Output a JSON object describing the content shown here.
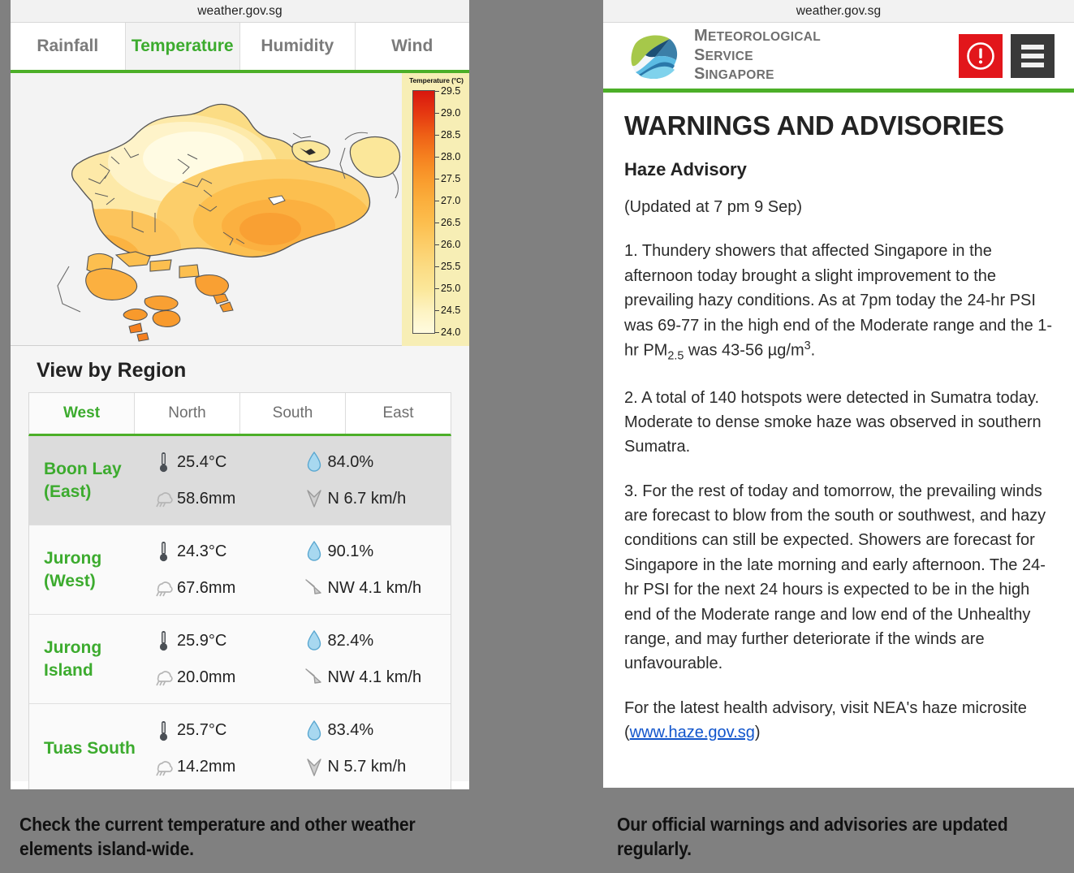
{
  "colors": {
    "accent_green": "#4caf28",
    "alert_red": "#e2161b",
    "menu_dark": "#3a3a3a",
    "link_blue": "#1155cc",
    "page_background": "#808080"
  },
  "left_screen": {
    "url": "weather.gov.sg",
    "tabs": [
      {
        "label": "Rainfall",
        "active": false
      },
      {
        "label": "Temperature",
        "active": true
      },
      {
        "label": "Humidity",
        "active": false
      },
      {
        "label": "Wind",
        "active": false
      }
    ],
    "map": {
      "legend_title": "Temperature (°C)",
      "legend_ticks": [
        "29.5",
        "29.0",
        "28.5",
        "28.0",
        "27.5",
        "27.0",
        "26.5",
        "26.0",
        "25.5",
        "25.0",
        "24.5",
        "24.0"
      ]
    },
    "region_section": {
      "title": "View by Region",
      "region_tabs": [
        {
          "label": "West",
          "active": true
        },
        {
          "label": "North",
          "active": false
        },
        {
          "label": "South",
          "active": false
        },
        {
          "label": "East",
          "active": false
        }
      ],
      "rows": [
        {
          "name": "Boon Lay (East)",
          "name_line1": "Boon Lay",
          "name_line2": "(East)",
          "temperature": "25.4°C",
          "rainfall": "58.6mm",
          "humidity": "84.0%",
          "wind": "N 6.7 km/h",
          "wind_icon": "wind-arrow-n"
        },
        {
          "name": "Jurong (West)",
          "name_line1": "Jurong",
          "name_line2": "(West)",
          "temperature": "24.3°C",
          "rainfall": "67.6mm",
          "humidity": "90.1%",
          "wind": "NW 4.1 km/h",
          "wind_icon": "wind-arrow-nw"
        },
        {
          "name": "Jurong Island",
          "name_line1": "Jurong",
          "name_line2": "Island",
          "temperature": "25.9°C",
          "rainfall": "20.0mm",
          "humidity": "82.4%",
          "wind": "NW 4.1 km/h",
          "wind_icon": "wind-arrow-nw"
        },
        {
          "name": "Tuas South",
          "name_line1": "Tuas South",
          "name_line2": "",
          "temperature": "25.7°C",
          "rainfall": "14.2mm",
          "humidity": "83.4%",
          "wind": "N 5.7 km/h",
          "wind_icon": "wind-arrow-n"
        }
      ]
    },
    "caption": "Check the current temperature and other weather elements island-wide."
  },
  "right_screen": {
    "url": "weather.gov.sg",
    "logo": {
      "line1": "Meteorological",
      "line2": "Service",
      "line3": "Singapore"
    },
    "header_buttons": {
      "alert": "alert-icon",
      "menu": "hamburger-menu-icon"
    },
    "heading": "WARNINGS AND ADVISORIES",
    "subheading": "Haze Advisory",
    "updated": "(Updated at 7 pm 9 Sep)",
    "paragraph1_a": "1. Thundery showers that affected Singapore in the afternoon today brought a slight improvement to the prevailing hazy conditions. As at 7pm today the 24-hr PSI was 69-77 in the high end of the Moderate range and the 1-hr PM",
    "paragraph1_sub": "2.5",
    "paragraph1_b": " was 43-56 µg/m",
    "paragraph1_sup": "3",
    "paragraph1_c": ".",
    "paragraph2": "2. A total of 140 hotspots were detected in Sumatra today. Moderate to dense smoke haze was observed in southern Sumatra.",
    "paragraph3": "3. For the rest of today and tomorrow, the prevailing winds are forecast to blow from the south or southwest, and hazy conditions can still be expected. Showers are forecast for Singapore in the late morning and early afternoon. The 24-hr PSI for the next 24 hours is expected to be in the high end of the Moderate range and low end of the Unhealthy range, and may further deteriorate if the winds are unfavourable.",
    "paragraph4_a": "For the latest health advisory, visit NEA's haze microsite (",
    "paragraph4_link": "www.haze.gov.sg",
    "paragraph4_b": ")",
    "caption": "Our official warnings and advisories are updated regularly."
  },
  "chart_data": {
    "type": "heatmap",
    "title": "Temperature (°C)",
    "description": "Interpolated air-temperature contour map of Singapore",
    "legend_ticks": [
      29.5,
      29.0,
      28.5,
      28.0,
      27.5,
      27.0,
      26.5,
      26.0,
      25.5,
      25.0,
      24.5,
      24.0
    ],
    "zlim": [
      24.0,
      29.5
    ],
    "unit": "°C",
    "station_values": [
      {
        "station": "Boon Lay (East)",
        "value": 25.4
      },
      {
        "station": "Jurong (West)",
        "value": 24.3
      },
      {
        "station": "Jurong Island",
        "value": 25.9
      },
      {
        "station": "Tuas South",
        "value": 25.7
      }
    ],
    "colorscale": [
      "#fffbdf",
      "#fdf3c2",
      "#fbe79a",
      "#fbdc84",
      "#fcce6a",
      "#fcbf4f",
      "#fbae3c",
      "#f99a2c",
      "#f5801f",
      "#ee5f16",
      "#e53711",
      "#d8170e"
    ],
    "legend_position": "right",
    "grid": false
  }
}
